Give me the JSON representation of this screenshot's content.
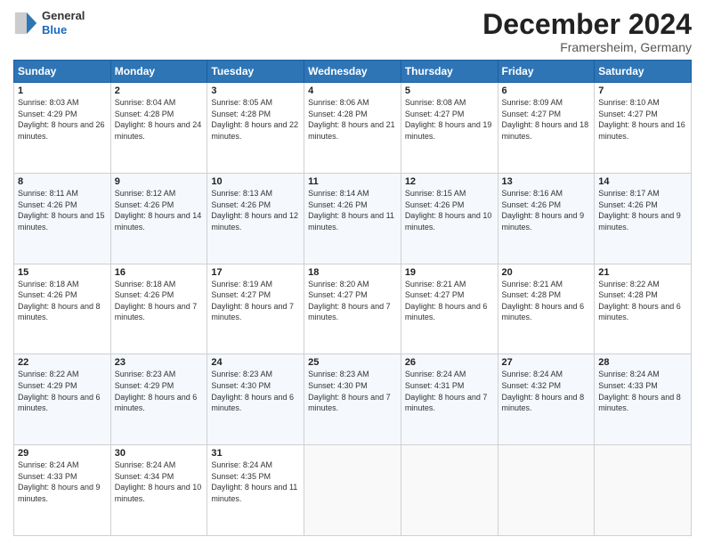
{
  "header": {
    "logo_general": "General",
    "logo_blue": "Blue",
    "month_title": "December 2024",
    "location": "Framersheim, Germany"
  },
  "days_of_week": [
    "Sunday",
    "Monday",
    "Tuesday",
    "Wednesday",
    "Thursday",
    "Friday",
    "Saturday"
  ],
  "weeks": [
    [
      {
        "day": "1",
        "sunrise": "8:03 AM",
        "sunset": "4:29 PM",
        "daylight": "8 hours and 26 minutes."
      },
      {
        "day": "2",
        "sunrise": "8:04 AM",
        "sunset": "4:28 PM",
        "daylight": "8 hours and 24 minutes."
      },
      {
        "day": "3",
        "sunrise": "8:05 AM",
        "sunset": "4:28 PM",
        "daylight": "8 hours and 22 minutes."
      },
      {
        "day": "4",
        "sunrise": "8:06 AM",
        "sunset": "4:28 PM",
        "daylight": "8 hours and 21 minutes."
      },
      {
        "day": "5",
        "sunrise": "8:08 AM",
        "sunset": "4:27 PM",
        "daylight": "8 hours and 19 minutes."
      },
      {
        "day": "6",
        "sunrise": "8:09 AM",
        "sunset": "4:27 PM",
        "daylight": "8 hours and 18 minutes."
      },
      {
        "day": "7",
        "sunrise": "8:10 AM",
        "sunset": "4:27 PM",
        "daylight": "8 hours and 16 minutes."
      }
    ],
    [
      {
        "day": "8",
        "sunrise": "8:11 AM",
        "sunset": "4:26 PM",
        "daylight": "8 hours and 15 minutes."
      },
      {
        "day": "9",
        "sunrise": "8:12 AM",
        "sunset": "4:26 PM",
        "daylight": "8 hours and 14 minutes."
      },
      {
        "day": "10",
        "sunrise": "8:13 AM",
        "sunset": "4:26 PM",
        "daylight": "8 hours and 12 minutes."
      },
      {
        "day": "11",
        "sunrise": "8:14 AM",
        "sunset": "4:26 PM",
        "daylight": "8 hours and 11 minutes."
      },
      {
        "day": "12",
        "sunrise": "8:15 AM",
        "sunset": "4:26 PM",
        "daylight": "8 hours and 10 minutes."
      },
      {
        "day": "13",
        "sunrise": "8:16 AM",
        "sunset": "4:26 PM",
        "daylight": "8 hours and 9 minutes."
      },
      {
        "day": "14",
        "sunrise": "8:17 AM",
        "sunset": "4:26 PM",
        "daylight": "8 hours and 9 minutes."
      }
    ],
    [
      {
        "day": "15",
        "sunrise": "8:18 AM",
        "sunset": "4:26 PM",
        "daylight": "8 hours and 8 minutes."
      },
      {
        "day": "16",
        "sunrise": "8:18 AM",
        "sunset": "4:26 PM",
        "daylight": "8 hours and 7 minutes."
      },
      {
        "day": "17",
        "sunrise": "8:19 AM",
        "sunset": "4:27 PM",
        "daylight": "8 hours and 7 minutes."
      },
      {
        "day": "18",
        "sunrise": "8:20 AM",
        "sunset": "4:27 PM",
        "daylight": "8 hours and 7 minutes."
      },
      {
        "day": "19",
        "sunrise": "8:21 AM",
        "sunset": "4:27 PM",
        "daylight": "8 hours and 6 minutes."
      },
      {
        "day": "20",
        "sunrise": "8:21 AM",
        "sunset": "4:28 PM",
        "daylight": "8 hours and 6 minutes."
      },
      {
        "day": "21",
        "sunrise": "8:22 AM",
        "sunset": "4:28 PM",
        "daylight": "8 hours and 6 minutes."
      }
    ],
    [
      {
        "day": "22",
        "sunrise": "8:22 AM",
        "sunset": "4:29 PM",
        "daylight": "8 hours and 6 minutes."
      },
      {
        "day": "23",
        "sunrise": "8:23 AM",
        "sunset": "4:29 PM",
        "daylight": "8 hours and 6 minutes."
      },
      {
        "day": "24",
        "sunrise": "8:23 AM",
        "sunset": "4:30 PM",
        "daylight": "8 hours and 6 minutes."
      },
      {
        "day": "25",
        "sunrise": "8:23 AM",
        "sunset": "4:30 PM",
        "daylight": "8 hours and 7 minutes."
      },
      {
        "day": "26",
        "sunrise": "8:24 AM",
        "sunset": "4:31 PM",
        "daylight": "8 hours and 7 minutes."
      },
      {
        "day": "27",
        "sunrise": "8:24 AM",
        "sunset": "4:32 PM",
        "daylight": "8 hours and 8 minutes."
      },
      {
        "day": "28",
        "sunrise": "8:24 AM",
        "sunset": "4:33 PM",
        "daylight": "8 hours and 8 minutes."
      }
    ],
    [
      {
        "day": "29",
        "sunrise": "8:24 AM",
        "sunset": "4:33 PM",
        "daylight": "8 hours and 9 minutes."
      },
      {
        "day": "30",
        "sunrise": "8:24 AM",
        "sunset": "4:34 PM",
        "daylight": "8 hours and 10 minutes."
      },
      {
        "day": "31",
        "sunrise": "8:24 AM",
        "sunset": "4:35 PM",
        "daylight": "8 hours and 11 minutes."
      },
      null,
      null,
      null,
      null
    ]
  ]
}
